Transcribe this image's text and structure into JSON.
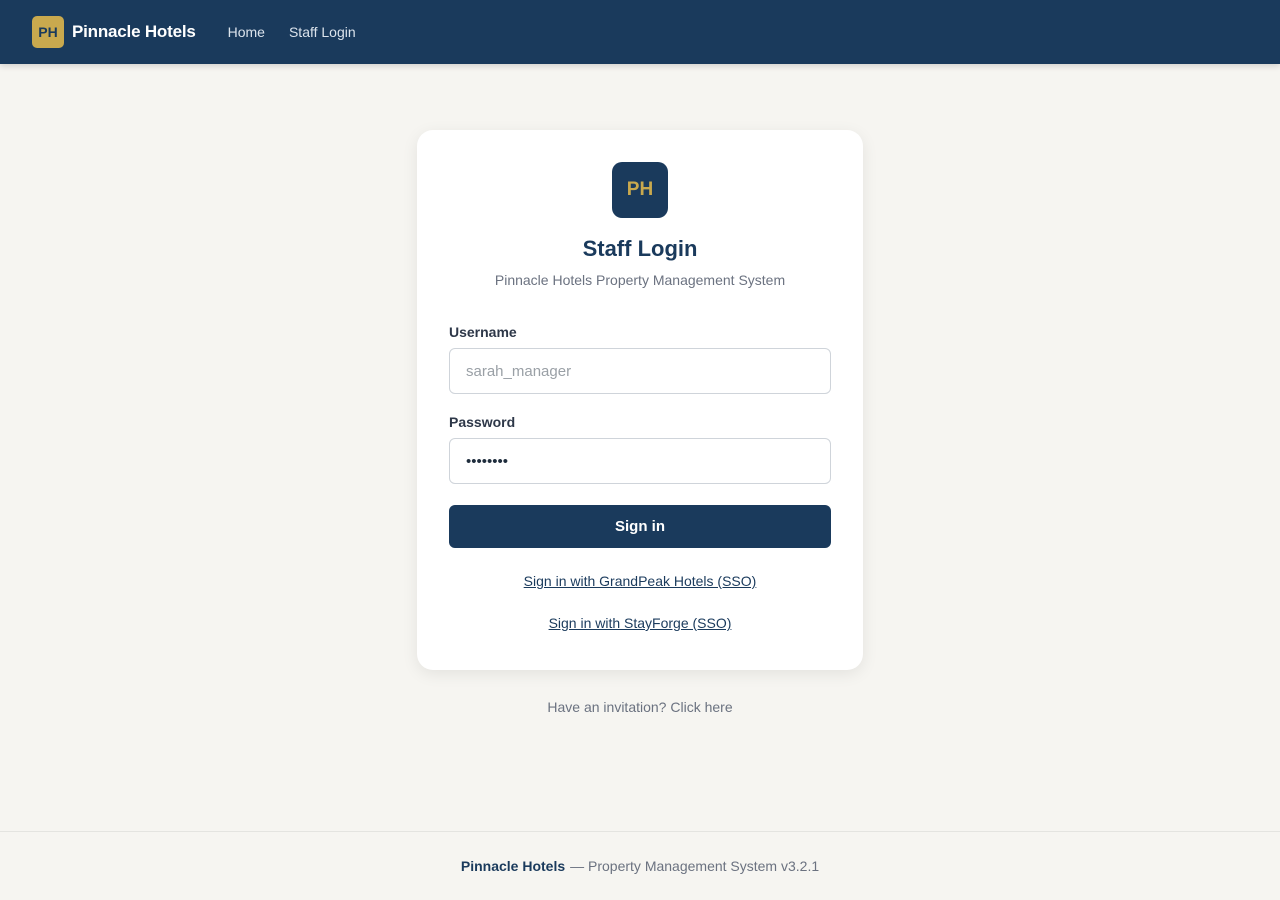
{
  "header": {
    "logo_text": "PH",
    "brand_name": "Pinnacle Hotels",
    "nav": [
      {
        "label": "Home"
      },
      {
        "label": "Staff Login"
      }
    ]
  },
  "login": {
    "logo_text": "PH",
    "title": "Staff Login",
    "subtitle": "Pinnacle Hotels Property Management System",
    "username": {
      "label": "Username",
      "placeholder": "sarah_manager",
      "value": ""
    },
    "password": {
      "label": "Password",
      "value": "••••••••"
    },
    "submit_label": "Sign in",
    "sso_links": [
      {
        "label": "Sign in with GrandPeak Hotels (SSO)"
      },
      {
        "label": "Sign in with StayForge (SSO)"
      }
    ]
  },
  "invite": {
    "prompt": "Have an invitation?",
    "link_label": "Click here"
  },
  "footer": {
    "brand": "Pinnacle Hotels",
    "text": "— Property Management System v3.2.1"
  },
  "colors": {
    "primary": "#1a3a5c",
    "accent": "#c9a94e",
    "background": "#f6f5f1"
  }
}
